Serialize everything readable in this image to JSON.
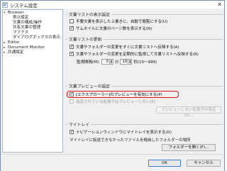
{
  "window": {
    "title": "システム設定",
    "close_glyph": "✕"
  },
  "tree": {
    "items": [
      {
        "label": "Browser",
        "expanded": true,
        "level": 0
      },
      {
        "label": "表示設定",
        "level": 1
      },
      {
        "label": "文書の構成/操作",
        "level": 1
      },
      {
        "label": "共有文書の管理",
        "level": 1
      },
      {
        "label": "ファクス",
        "level": 1
      },
      {
        "label": "ダイアログボックスの表示",
        "level": 1
      },
      {
        "label": "Editor",
        "expanded": false,
        "level": 0
      },
      {
        "label": "Document Monitor",
        "expanded": false,
        "level": 0
      },
      {
        "label": "共通設定",
        "expanded": false,
        "level": 0
      }
    ]
  },
  "sections": {
    "display": {
      "title": "文書リストの表示設定",
      "opt1": "不要文書を表示した上書きに、自動で閲覧にする(U)",
      "opt2": "サムネイルに文書のページ数を表示する(N)"
    },
    "update": {
      "title": "文書リストの更新",
      "opt1": "文書やフォルダーの変更をすぐに文書リストへ反映する(A)",
      "opt2": "文書やフォルダーの変更を定期的に監視して文書リストへ反映する(R)",
      "interval_label": "監視間隔(M):",
      "min_value": "0",
      "min_unit": "分",
      "sec_value": "10",
      "sec_unit": "秒(10〜999)"
    },
    "preview": {
      "title": "文書プレビューの設定",
      "opt1": "[エクスプローラー]のプレビューを有効にする(P)",
      "opt2": "指定されている拡張子はプレビューしない(E)",
      "button": "プレビューしない拡張子の設定(S)..."
    },
    "mytray": {
      "title": "マイトレイ",
      "opt1": "ナビゲーションウィンドウにマイトレイを表示する(D)",
      "note": "マイトレイに転送できなかったファイルを格納したフォルダーの場所",
      "button": "フォルダーを開く(F)..."
    }
  },
  "footer": {
    "ok": "OK",
    "cancel": "キャンセル"
  }
}
